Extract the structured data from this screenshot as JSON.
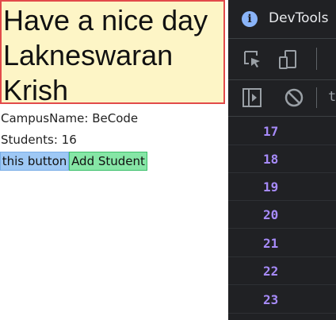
{
  "page": {
    "greeting_lines": [
      "Have a nice day",
      "Lakneswaran",
      "Krish"
    ],
    "campus_text": "CampusName: BeCode",
    "students_text": "Students: 16",
    "this_button_label": "this button",
    "add_student_label": "Add Student"
  },
  "devtools": {
    "title": "DevTools",
    "partial_label": "t",
    "line_numbers": [
      "17",
      "18",
      "19",
      "20",
      "21",
      "22",
      "23"
    ]
  },
  "colors": {
    "greeting_bg": "#fdf5c6",
    "greeting_border": "#e24a4a",
    "this_button_bg": "#9ec8f5",
    "add_button_bg": "#86e6a6",
    "devtools_bg": "#202124",
    "line_number": "#a78bfa"
  },
  "icons": [
    "info-icon",
    "inspect-element-icon",
    "device-toggle-icon",
    "toggle-sidebar-icon",
    "clear-console-icon"
  ]
}
